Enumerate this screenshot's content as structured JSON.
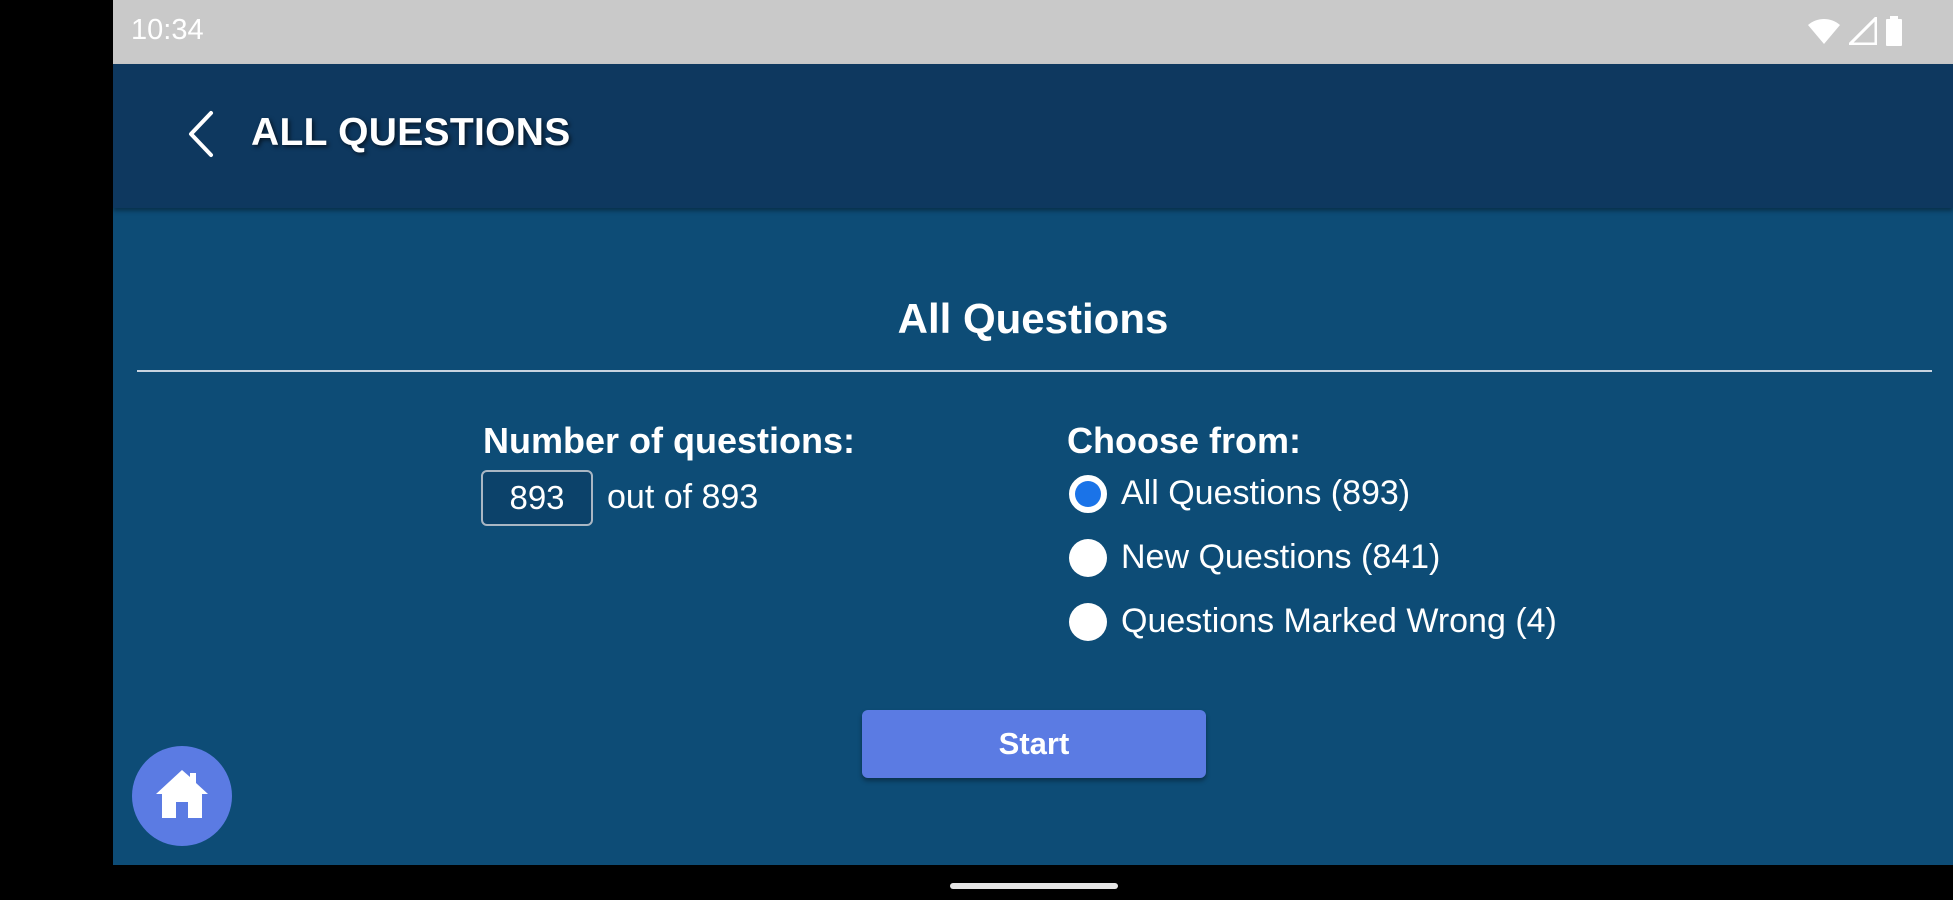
{
  "status_bar": {
    "time": "10:34",
    "icons": [
      "wifi-icon",
      "cell-signal-icon",
      "battery-icon"
    ]
  },
  "app_bar": {
    "back_icon": "chevron-left-icon",
    "title": "ALL QUESTIONS"
  },
  "main": {
    "section_title": "All Questions",
    "number_label": "Number of questions:",
    "number_value": "893",
    "out_of_text": "out of 893",
    "choose_label": "Choose from:",
    "options": [
      {
        "label": "All Questions (893)",
        "checked": true
      },
      {
        "label": "New Questions (841)",
        "checked": false
      },
      {
        "label": "Questions Marked Wrong (4)",
        "checked": false
      }
    ],
    "start_label": "Start"
  },
  "fab": {
    "icon": "home-icon"
  },
  "colors": {
    "background": "#0d4c76",
    "app_bar": "#0e385f",
    "accent": "#5b7be3",
    "radio_selected": "#1a73e8"
  }
}
